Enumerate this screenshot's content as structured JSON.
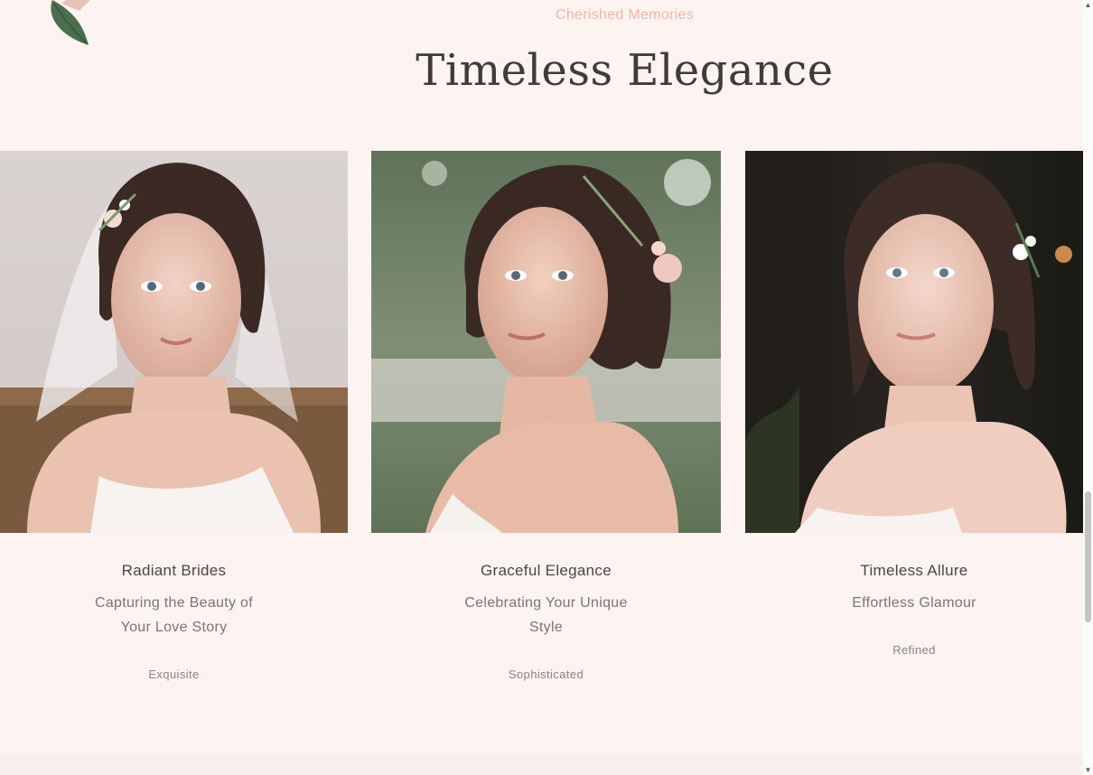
{
  "section": {
    "eyebrow": "Cherished Memories",
    "title": "Timeless Elegance"
  },
  "cards": [
    {
      "title": "Radiant Brides",
      "subtitle": "Capturing the Beauty of Your Love Story",
      "tag": "Exquisite",
      "image_alt": "Bride with veil and floral hairpiece in soft indoor light"
    },
    {
      "title": "Graceful Elegance",
      "subtitle": "Celebrating Your Unique Style",
      "tag": "Sophisticated",
      "image_alt": "Bride with low bun and pink rose in outdoor garden setting"
    },
    {
      "title": "Timeless Allure",
      "subtitle": "Effortless Glamour",
      "tag": "Refined",
      "image_alt": "Bride with loose curls against dark wooden background"
    }
  ],
  "colors": {
    "background": "#fdf4f1",
    "eyebrow": "#efb7a5",
    "title": "#3e3b3b",
    "accent_dot": "#c98a4c"
  },
  "icons": {
    "decoration": "rose-leaf-icon",
    "scroll_up": "chevron-up-icon",
    "scroll_down": "chevron-down-icon",
    "floating_dot": "dot-icon"
  }
}
